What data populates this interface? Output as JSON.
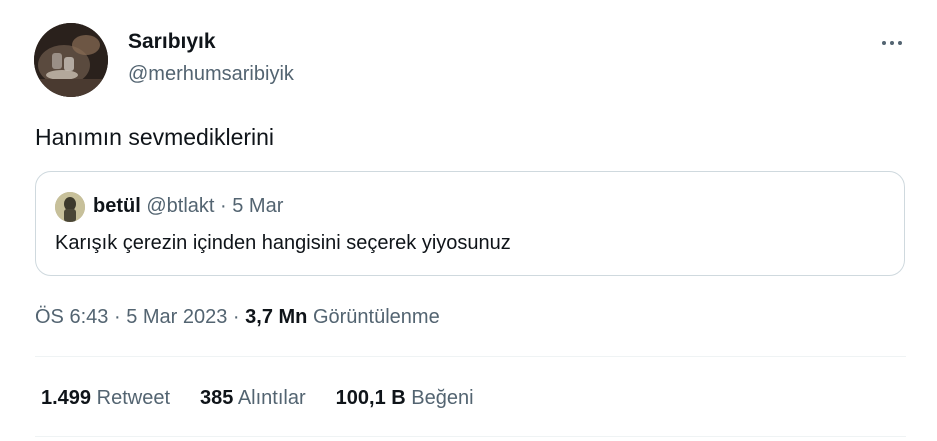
{
  "author": {
    "display_name": "Sarıbıyık",
    "handle": "@merhumsaribiyik"
  },
  "tweet_text": "Hanımın sevmediklerini",
  "quoted": {
    "name": "betül",
    "handle": "@btlakt",
    "separator": "·",
    "date": "5 Mar",
    "text": "Karışık çerezin içinden hangisini seçerek yiyosunuz"
  },
  "meta": {
    "time": "ÖS 6:43",
    "date": "5 Mar 2023",
    "separator": "·",
    "views_count": "3,7 Mn",
    "views_label": "Görüntülenme"
  },
  "stats": [
    {
      "count": "1.499",
      "label": "Retweet"
    },
    {
      "count": "385",
      "label": "Alıntılar"
    },
    {
      "count": "100,1 B",
      "label": "Beğeni"
    }
  ],
  "icons": {
    "more": "more-horizontal-icon"
  }
}
